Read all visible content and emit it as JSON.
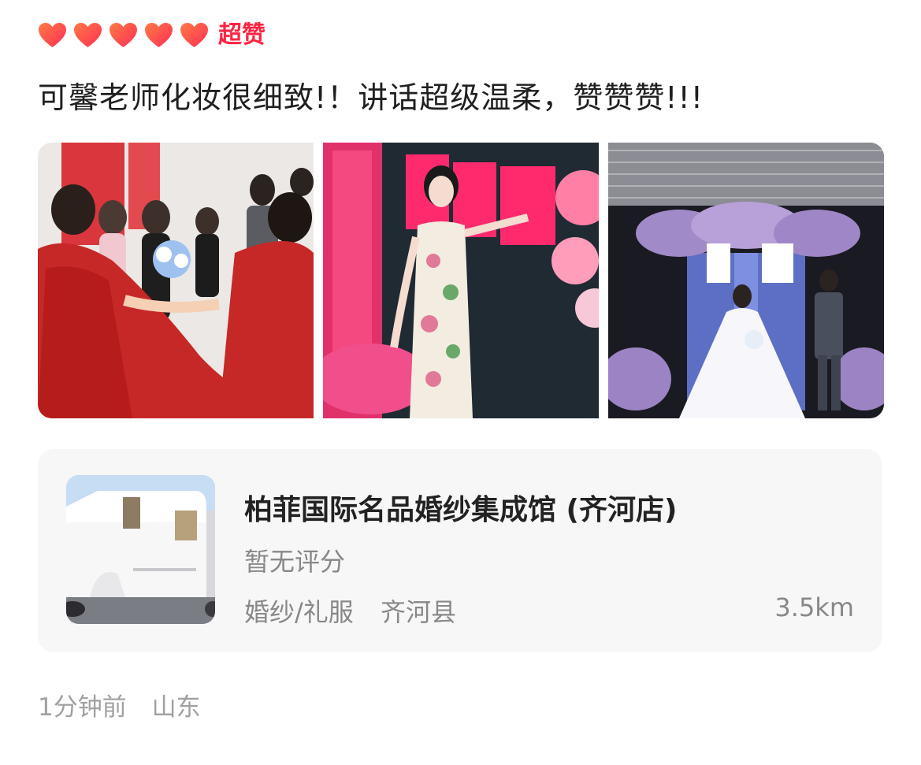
{
  "rating": {
    "hearts": 5,
    "heart_color": "#ff4d4f",
    "label": "超赞",
    "label_color": "#ff2442"
  },
  "review": {
    "text": "可馨老师化妆很细致!！讲话超级温柔，赞赞赞!!!"
  },
  "photos": [
    {
      "name": "wedding-photo-red-gowns"
    },
    {
      "name": "wedding-photo-qipao-bride"
    },
    {
      "name": "wedding-photo-white-gown-stage"
    }
  ],
  "shop": {
    "name": "柏菲国际名品婚纱集成馆 (齐河店)",
    "score_text": "暂无评分",
    "category": "婚纱/礼服",
    "district": "齐河县",
    "distance": "3.5km"
  },
  "footer": {
    "time": "1分钟前",
    "location": "山东"
  }
}
